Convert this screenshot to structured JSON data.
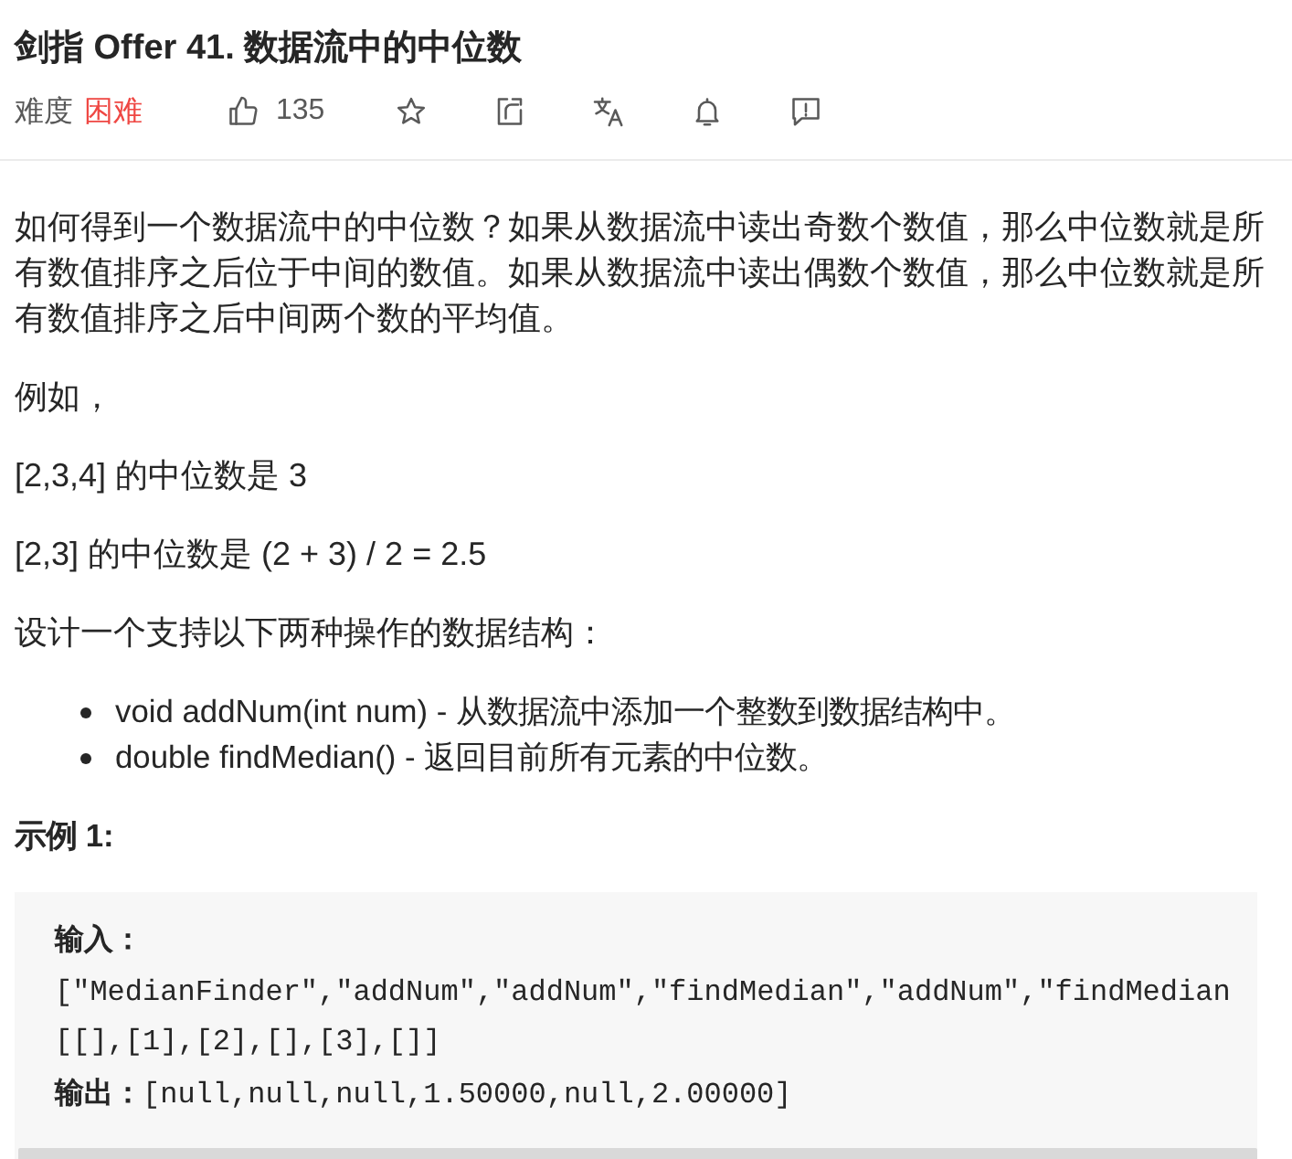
{
  "problem": {
    "title": "剑指 Offer 41. 数据流中的中位数"
  },
  "toolbar": {
    "difficulty_caption": "难度",
    "difficulty": {
      "text": "困难",
      "kind": "hard"
    },
    "actions": [
      {
        "kind": "like",
        "count": "135"
      },
      {
        "kind": "favorite"
      },
      {
        "kind": "share"
      },
      {
        "kind": "translate"
      },
      {
        "kind": "subscribe"
      },
      {
        "kind": "feedback"
      }
    ]
  },
  "description": [
    {
      "kind": "paragraph",
      "text": "如何得到一个数据流中的中位数？如果从数据流中读出奇数个数值，那么中位数就是所有数值排序之后位于中间的数值。如果从数据流中读出偶数个数值，那么中位数就是所有数值排序之后中间两个数的平均值。"
    },
    {
      "kind": "paragraph",
      "text": "例如，"
    },
    {
      "kind": "paragraph",
      "text": "[2,3,4] 的中位数是 3"
    },
    {
      "kind": "paragraph",
      "text": "[2,3] 的中位数是 (2 + 3) / 2 = 2.5"
    },
    {
      "kind": "paragraph",
      "text": "设计一个支持以下两种操作的数据结构："
    },
    {
      "kind": "bullets",
      "items": [
        "void addNum(int num) - 从数据流中添加一个整数到数据结构中。",
        "double findMedian() - 返回目前所有元素的中位数。"
      ]
    },
    {
      "kind": "heading",
      "text": "示例 1:"
    },
    {
      "kind": "code",
      "lines": [
        {
          "label": "输入："
        },
        {
          "text": "[\"MedianFinder\",\"addNum\",\"addNum\",\"findMedian\",\"addNum\",\"findMedian"
        },
        {
          "text": "[[],[1],[2],[],[3],[]]"
        },
        {
          "label": "输出：",
          "text": "[null,null,null,1.50000,null,2.00000]"
        }
      ]
    }
  ]
}
